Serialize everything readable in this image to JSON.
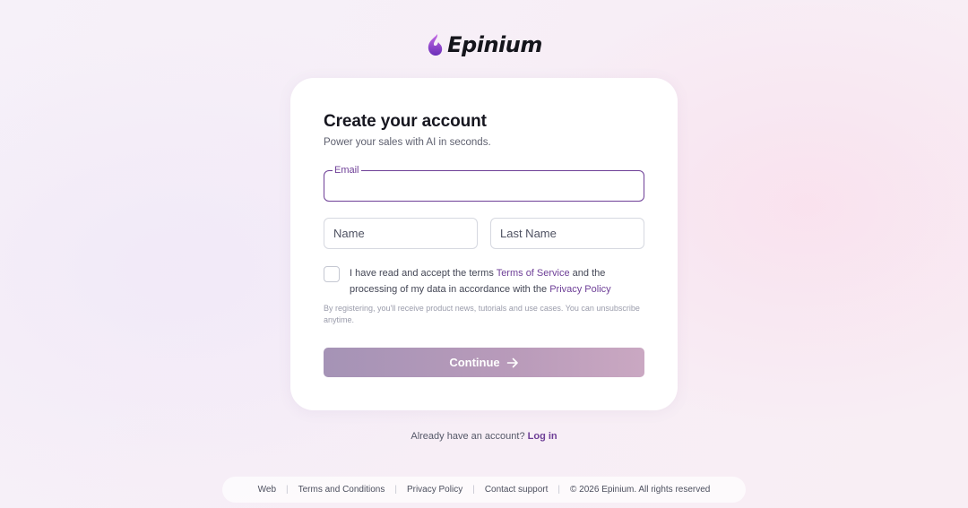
{
  "brand": {
    "name": "Epinium",
    "logo_icon": "flame-icon",
    "logo_gradient": [
      "#c66be6",
      "#6a2fb8"
    ]
  },
  "colors": {
    "accent": "#6e3f97",
    "button_gradient_start": "#a593b6",
    "button_gradient_end": "#caa8c2",
    "card_background": "#ffffff"
  },
  "form": {
    "title": "Create your account",
    "subtitle": "Power your sales with AI in seconds.",
    "email_label": "Email",
    "email_value": "",
    "name_placeholder": "Name",
    "last_name_placeholder": "Last Name",
    "consent_checked": false,
    "consent_text_1": "I have read and accept the terms ",
    "consent_link_terms": "Terms of Service",
    "consent_text_2": " and the processing of my data in accordance with the ",
    "consent_link_privacy": "Privacy Policy",
    "notice": "By registering, you'll receive product news, tutorials and use cases. You can unsubscribe anytime.",
    "continue_label": "Continue",
    "continue_icon": "arrow-right-icon"
  },
  "login": {
    "prompt": "Already have an account?",
    "link": "Log in"
  },
  "footer": {
    "links": [
      "Web",
      "Terms and Conditions",
      "Privacy Policy",
      "Contact support"
    ],
    "separator": "|",
    "copyright": "© 2026 Epinium. All rights reserved"
  }
}
